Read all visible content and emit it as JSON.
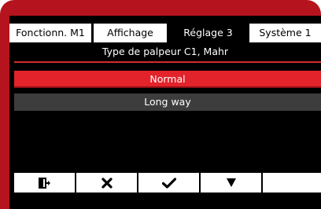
{
  "tabs": [
    {
      "label": "Fonctionn. M1"
    },
    {
      "label": "Affichage"
    },
    {
      "label": "Réglage 3"
    },
    {
      "label": "Système 1"
    }
  ],
  "active_tab": "Réglage 3",
  "subtitle": "Type de palpeur C1, Mahr",
  "options": [
    {
      "label": "Normal",
      "selected": true
    },
    {
      "label": "Long way",
      "selected": false
    }
  ],
  "softkeys": [
    {
      "icon": "exit-icon"
    },
    {
      "icon": "cancel-x-icon"
    },
    {
      "icon": "checkmark-icon"
    },
    {
      "icon": "down-triangle-icon"
    },
    {
      "icon": ""
    }
  ],
  "colors": {
    "bezel": "#b5141e",
    "selected_option": "#e2232b",
    "option_background": "#3d3d3d",
    "screen": "#000000"
  }
}
